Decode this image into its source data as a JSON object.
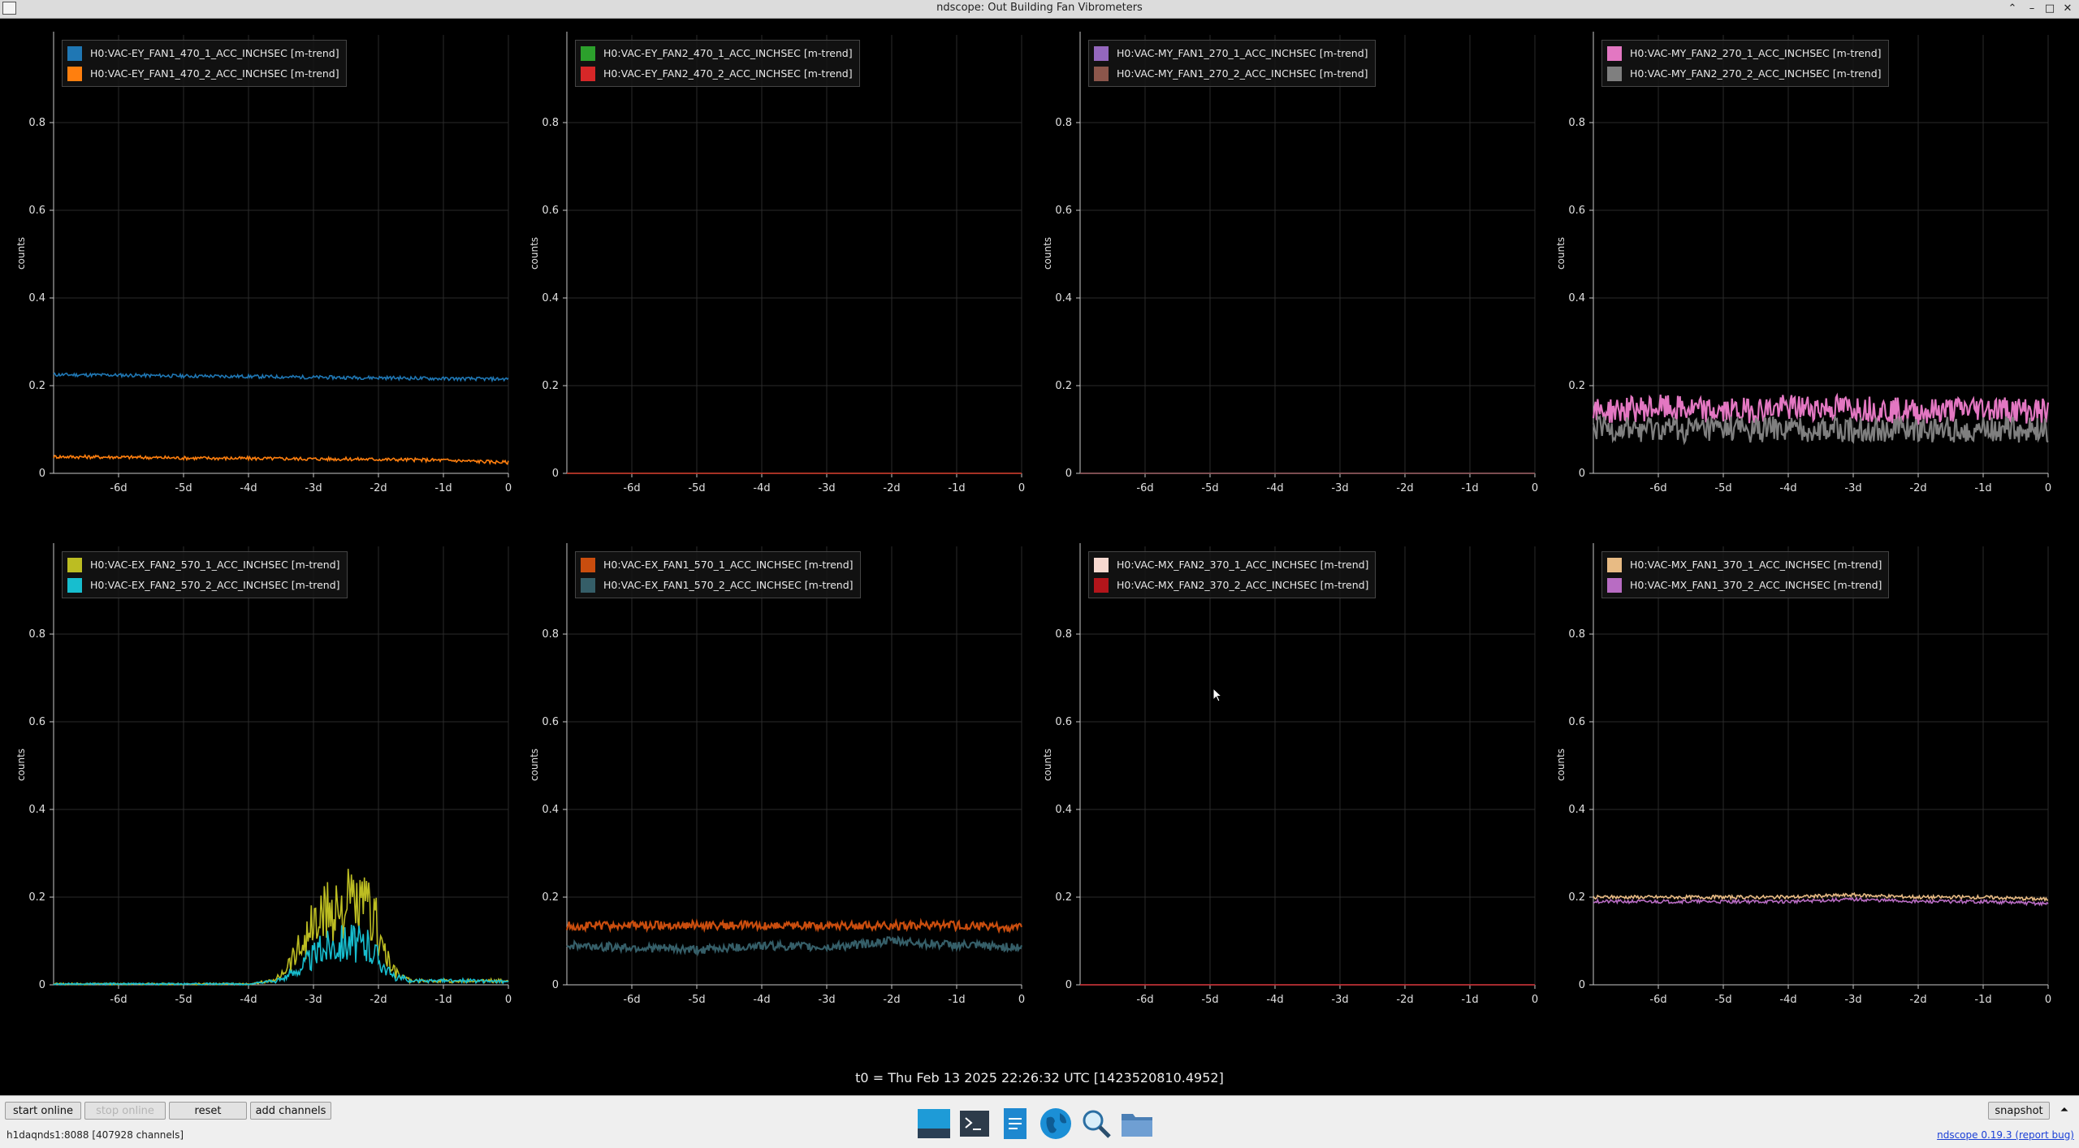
{
  "window": {
    "title": "ndscope: Out Building Fan Vibrometers",
    "minimize": "–",
    "maximize": "□",
    "close": "✕",
    "shade": "⌃"
  },
  "axes": {
    "ylabel": "counts",
    "yticks": [
      "0",
      "0.2",
      "0.4",
      "0.6",
      "0.8"
    ],
    "xticks": [
      "-6d",
      "-5d",
      "-4d",
      "-3d",
      "-2d",
      "-1d",
      "0"
    ]
  },
  "plots": [
    {
      "legend": [
        {
          "label": "H0:VAC-EY_FAN1_470_1_ACC_INCHSEC [m-trend]",
          "color": "#1f77b4"
        },
        {
          "label": "H0:VAC-EY_FAN1_470_2_ACC_INCHSEC [m-trend]",
          "color": "#ff7f0e"
        }
      ]
    },
    {
      "legend": [
        {
          "label": "H0:VAC-EY_FAN2_470_1_ACC_INCHSEC [m-trend]",
          "color": "#2ca02c"
        },
        {
          "label": "H0:VAC-EY_FAN2_470_2_ACC_INCHSEC [m-trend]",
          "color": "#d62728"
        }
      ]
    },
    {
      "legend": [
        {
          "label": "H0:VAC-MY_FAN1_270_1_ACC_INCHSEC [m-trend]",
          "color": "#9467bd"
        },
        {
          "label": "H0:VAC-MY_FAN1_270_2_ACC_INCHSEC [m-trend]",
          "color": "#8c564b"
        }
      ]
    },
    {
      "legend": [
        {
          "label": "H0:VAC-MY_FAN2_270_1_ACC_INCHSEC [m-trend]",
          "color": "#e377c2"
        },
        {
          "label": "H0:VAC-MY_FAN2_270_2_ACC_INCHSEC [m-trend]",
          "color": "#7f7f7f"
        }
      ]
    },
    {
      "legend": [
        {
          "label": "H0:VAC-EX_FAN2_570_1_ACC_INCHSEC [m-trend]",
          "color": "#bcbd22"
        },
        {
          "label": "H0:VAC-EX_FAN2_570_2_ACC_INCHSEC [m-trend]",
          "color": "#17becf"
        }
      ]
    },
    {
      "legend": [
        {
          "label": "H0:VAC-EX_FAN1_570_1_ACC_INCHSEC [m-trend]",
          "color": "#c94d0e"
        },
        {
          "label": "H0:VAC-EX_FAN1_570_2_ACC_INCHSEC [m-trend]",
          "color": "#355e68"
        }
      ]
    },
    {
      "legend": [
        {
          "label": "H0:VAC-MX_FAN2_370_1_ACC_INCHSEC [m-trend]",
          "color": "#f7d9d0"
        },
        {
          "label": "H0:VAC-MX_FAN2_370_2_ACC_INCHSEC [m-trend]",
          "color": "#b3151b"
        }
      ]
    },
    {
      "legend": [
        {
          "label": "H0:VAC-MX_FAN1_370_1_ACC_INCHSEC [m-trend]",
          "color": "#e8bb84"
        },
        {
          "label": "H0:VAC-MX_FAN1_370_2_ACC_INCHSEC [m-trend]",
          "color": "#b86cc3"
        }
      ]
    }
  ],
  "chart_data": [
    {
      "type": "line",
      "xlim": [
        -7,
        0
      ],
      "ylim": [
        0,
        1
      ],
      "series": [
        {
          "name": "H0:VAC-EY_FAN1_470_1_ACC_INCHSEC [m-trend]",
          "x": [
            -7,
            -6,
            -5,
            -4,
            -3,
            -2,
            -1,
            0
          ],
          "y": [
            0.225,
            0.224,
            0.222,
            0.221,
            0.219,
            0.218,
            0.216,
            0.215
          ]
        },
        {
          "name": "H0:VAC-EY_FAN1_470_2_ACC_INCHSEC [m-trend]",
          "x": [
            -7,
            -6,
            -5,
            -4,
            -3,
            -2,
            -1,
            0
          ],
          "y": [
            0.038,
            0.037,
            0.035,
            0.034,
            0.033,
            0.032,
            0.03,
            0.025
          ]
        }
      ]
    },
    {
      "type": "line",
      "xlim": [
        -7,
        0
      ],
      "ylim": [
        0,
        1
      ],
      "series": [
        {
          "name": "H0:VAC-EY_FAN2_470_1_ACC_INCHSEC [m-trend]",
          "x": [
            -7,
            0
          ],
          "y": [
            0,
            0
          ]
        },
        {
          "name": "H0:VAC-EY_FAN2_470_2_ACC_INCHSEC [m-trend]",
          "x": [
            -7,
            0
          ],
          "y": [
            0,
            0
          ]
        }
      ]
    },
    {
      "type": "line",
      "xlim": [
        -7,
        0
      ],
      "ylim": [
        0,
        1
      ],
      "series": [
        {
          "name": "H0:VAC-MY_FAN1_270_1_ACC_INCHSEC [m-trend]",
          "x": [
            -7,
            0
          ],
          "y": [
            0,
            0
          ]
        },
        {
          "name": "H0:VAC-MY_FAN1_270_2_ACC_INCHSEC [m-trend]",
          "x": [
            -7,
            0
          ],
          "y": [
            0,
            0
          ]
        }
      ]
    },
    {
      "type": "line",
      "xlim": [
        -7,
        0
      ],
      "ylim": [
        0,
        1
      ],
      "series": [
        {
          "name": "H0:VAC-MY_FAN2_270_1_ACC_INCHSEC [m-trend]",
          "x": [
            -7,
            -6,
            -5,
            -4,
            -3,
            -2,
            -1,
            0
          ],
          "y": [
            0.14,
            0.15,
            0.14,
            0.15,
            0.15,
            0.14,
            0.15,
            0.14
          ]
        },
        {
          "name": "H0:VAC-MY_FAN2_270_2_ACC_INCHSEC [m-trend]",
          "x": [
            -7,
            -6,
            -5,
            -4,
            -3,
            -2,
            -1,
            0
          ],
          "y": [
            0.1,
            0.1,
            0.1,
            0.1,
            0.1,
            0.1,
            0.1,
            0.1
          ]
        }
      ]
    },
    {
      "type": "line",
      "xlim": [
        -7,
        0
      ],
      "ylim": [
        0,
        1
      ],
      "series": [
        {
          "name": "H0:VAC-EX_FAN2_570_1_ACC_INCHSEC [m-trend]",
          "x": [
            -7,
            -4,
            -3.6,
            -3.3,
            -3.0,
            -2.7,
            -2.4,
            -2.1,
            -1.8,
            -1.5,
            0
          ],
          "y": [
            0,
            0,
            0.01,
            0.1,
            0.2,
            0.26,
            0.27,
            0.25,
            0.05,
            0.01,
            0.01
          ]
        },
        {
          "name": "H0:VAC-EX_FAN2_570_2_ACC_INCHSEC [m-trend]",
          "x": [
            -7,
            -4,
            -3.6,
            -3.3,
            -3.0,
            -2.7,
            -2.4,
            -2.1,
            -1.8,
            -1.5,
            0
          ],
          "y": [
            0,
            0,
            0.01,
            0.04,
            0.1,
            0.14,
            0.15,
            0.12,
            0.03,
            0.01,
            0.01
          ]
        }
      ]
    },
    {
      "type": "line",
      "xlim": [
        -7,
        0
      ],
      "ylim": [
        0,
        1
      ],
      "series": [
        {
          "name": "H0:VAC-EX_FAN1_570_1_ACC_INCHSEC [m-trend]",
          "x": [
            -7,
            -6,
            -5,
            -4,
            -3,
            -2,
            -1,
            0
          ],
          "y": [
            0.135,
            0.135,
            0.136,
            0.135,
            0.136,
            0.135,
            0.135,
            0.13
          ]
        },
        {
          "name": "H0:VAC-EX_FAN1_570_2_ACC_INCHSEC [m-trend]",
          "x": [
            -7,
            -6,
            -5,
            -4,
            -3,
            -2,
            -1,
            0
          ],
          "y": [
            0.09,
            0.085,
            0.08,
            0.09,
            0.085,
            0.1,
            0.09,
            0.085
          ]
        }
      ]
    },
    {
      "type": "line",
      "xlim": [
        -7,
        0
      ],
      "ylim": [
        0,
        1
      ],
      "series": [
        {
          "name": "H0:VAC-MX_FAN2_370_1_ACC_INCHSEC [m-trend]",
          "x": [
            -7,
            0
          ],
          "y": [
            0,
            0
          ]
        },
        {
          "name": "H0:VAC-MX_FAN2_370_2_ACC_INCHSEC [m-trend]",
          "x": [
            -7,
            0
          ],
          "y": [
            0,
            0
          ]
        }
      ]
    },
    {
      "type": "line",
      "xlim": [
        -7,
        0
      ],
      "ylim": [
        0,
        1
      ],
      "series": [
        {
          "name": "H0:VAC-MX_FAN1_370_1_ACC_INCHSEC [m-trend]",
          "x": [
            -7,
            -6,
            -5,
            -4,
            -3,
            -2,
            -1,
            0
          ],
          "y": [
            0.2,
            0.2,
            0.2,
            0.2,
            0.205,
            0.2,
            0.2,
            0.195
          ]
        },
        {
          "name": "H0:VAC-MX_FAN1_370_2_ACC_INCHSEC [m-trend]",
          "x": [
            -7,
            -6,
            -5,
            -4,
            -3,
            -2,
            -1,
            0
          ],
          "y": [
            0.19,
            0.19,
            0.19,
            0.19,
            0.195,
            0.19,
            0.19,
            0.185
          ]
        }
      ]
    }
  ],
  "t0_label": "t0 = Thu Feb 13 2025 22:26:32 UTC [1423520810.4952]",
  "controls": {
    "start_online": "start online",
    "stop_online": "stop online",
    "reset": "reset",
    "add_channels": "add channels",
    "snapshot": "snapshot",
    "expand": "⏶"
  },
  "status": "h1daqnds1:8088  [407928 channels]",
  "version": "ndscope 0.19.3 (report bug)",
  "taskbar": [
    "desktop-icon",
    "terminal-icon",
    "text-editor-icon",
    "web-browser-icon",
    "search-icon",
    "file-manager-icon"
  ]
}
